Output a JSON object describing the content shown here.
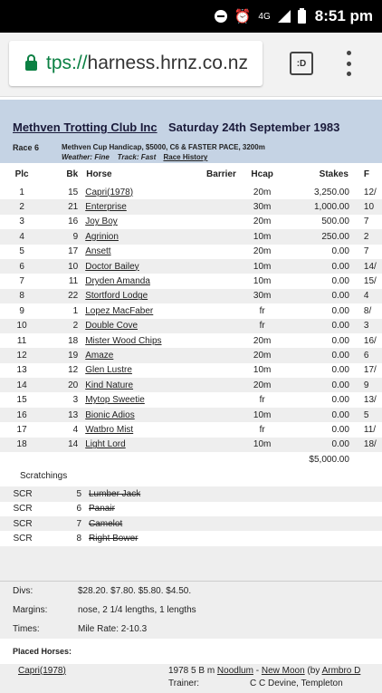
{
  "status_bar": {
    "network": "4G",
    "time": "8:51 pm"
  },
  "browser": {
    "url_scheme": "tps://",
    "url_host": "harness.hrnz.co.nz",
    "tabs_label": ":D"
  },
  "meeting": {
    "club": "Methven Trotting Club Inc",
    "date": "Saturday  24th  September  1983"
  },
  "race": {
    "number": "Race 6",
    "description": "Methven Cup Handicap, $5000, C6 & FASTER PACE, 3200m",
    "weather_label": "Weather:",
    "weather": "Fine",
    "track_label": "Track:",
    "track": "Fast",
    "history_link": "Race History"
  },
  "results": {
    "headers": [
      "Plc",
      "Bk",
      "Horse",
      "Barrier",
      "Hcap",
      "Stakes",
      "F"
    ],
    "rows": [
      [
        "1",
        "15",
        "Capri(1978)",
        "",
        "20m",
        "3,250.00",
        "12/"
      ],
      [
        "2",
        "21",
        "Enterprise",
        "",
        "30m",
        "1,000.00",
        "10"
      ],
      [
        "3",
        "16",
        "Joy Boy",
        "",
        "20m",
        "500.00",
        "7"
      ],
      [
        "4",
        "9",
        "Agrinion",
        "",
        "10m",
        "250.00",
        "2"
      ],
      [
        "5",
        "17",
        "Ansett",
        "",
        "20m",
        "0.00",
        "7"
      ],
      [
        "6",
        "10",
        "Doctor Bailey",
        "",
        "10m",
        "0.00",
        "14/"
      ],
      [
        "7",
        "11",
        "Dryden Amanda",
        "",
        "10m",
        "0.00",
        "15/"
      ],
      [
        "8",
        "22",
        "Stortford Lodge",
        "",
        "30m",
        "0.00",
        "4"
      ],
      [
        "9",
        "1",
        "Lopez MacFaber",
        "",
        "fr",
        "0.00",
        "8/"
      ],
      [
        "10",
        "2",
        "Double Cove",
        "",
        "fr",
        "0.00",
        "3"
      ],
      [
        "11",
        "18",
        "Mister Wood Chips",
        "",
        "20m",
        "0.00",
        "16/"
      ],
      [
        "12",
        "19",
        "Amaze",
        "",
        "20m",
        "0.00",
        "6"
      ],
      [
        "13",
        "12",
        "Glen Lustre",
        "",
        "10m",
        "0.00",
        "17/"
      ],
      [
        "14",
        "20",
        "Kind Nature",
        "",
        "20m",
        "0.00",
        "9"
      ],
      [
        "15",
        "3",
        "Mytop Sweetie",
        "",
        "fr",
        "0.00",
        "13/"
      ],
      [
        "16",
        "13",
        "Bionic Adios",
        "",
        "10m",
        "0.00",
        "5"
      ],
      [
        "17",
        "4",
        "Watbro Mist",
        "",
        "fr",
        "0.00",
        "11/"
      ],
      [
        "18",
        "14",
        "Light Lord",
        "",
        "10m",
        "0.00",
        "18/"
      ]
    ],
    "total_stakes": "$5,000.00"
  },
  "scratchings": {
    "title": "Scratchings",
    "rows": [
      [
        "SCR",
        "5",
        "Lumber Jack"
      ],
      [
        "SCR",
        "6",
        "Panair"
      ],
      [
        "SCR",
        "7",
        "Camelot"
      ],
      [
        "SCR",
        "8",
        "Right Bower"
      ]
    ]
  },
  "info": {
    "divs_label": "Divs:",
    "divs": "$28.20. $7.80. $5.80. $4.50.",
    "margins_label": "Margins:",
    "margins": "nose, 2 1/4 lengths, 1 lengths",
    "times_label": "Times:",
    "times": "Mile Rate: 2-10.3"
  },
  "placed": {
    "title": "Placed Horses:",
    "horse": "Capri(1978)",
    "desc_prefix": "1978 5 B m ",
    "sire": "Noodlum",
    "dash": " - ",
    "dam": "New Moon",
    "by_prefix": "  (by ",
    "damsire": "Armbro D",
    "trainer_label": "Trainer:",
    "trainer": "C C Devine, Templeton"
  }
}
